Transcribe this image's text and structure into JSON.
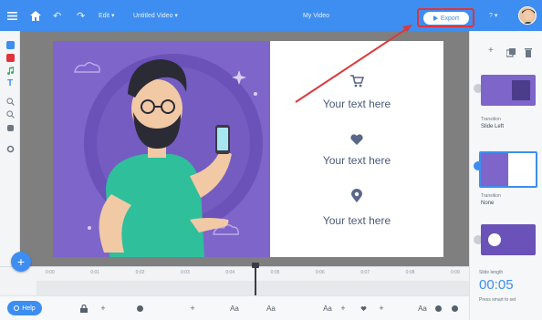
{
  "topbar": {
    "undo_label": "↶",
    "redo_label": "↷",
    "edit_label": "Edit ▾",
    "project_label": "Untitled Video ▾",
    "title": "My Video",
    "export_label": "Export",
    "help_label": "? ▾"
  },
  "slide": {
    "texts": [
      "Your text here",
      "Your text here",
      "Your text here"
    ]
  },
  "sidebar": {
    "transition1_label": "Transition",
    "transition1_value": "Slide Left",
    "transition2_label": "Transition",
    "transition2_value": "None",
    "length_label": "Slide length",
    "length_value": "00:05",
    "length_note": "Press smart to set"
  },
  "timeline": {
    "ticks": [
      "0:00",
      "0:01",
      "0:02",
      "0:03",
      "0:04",
      "0:05",
      "0:06",
      "0:07",
      "0:08",
      "0:09"
    ],
    "play_label": "Help",
    "font_labels": [
      "Aa",
      "Aa",
      "Aa",
      "Aa"
    ]
  },
  "colors": {
    "topbar": "#3d8ef0",
    "accent": "#3d8ef0",
    "slide_purple": "#7d65c9",
    "export_highlight": "#e0333b",
    "annotation_arrow": "#d93a3a"
  }
}
